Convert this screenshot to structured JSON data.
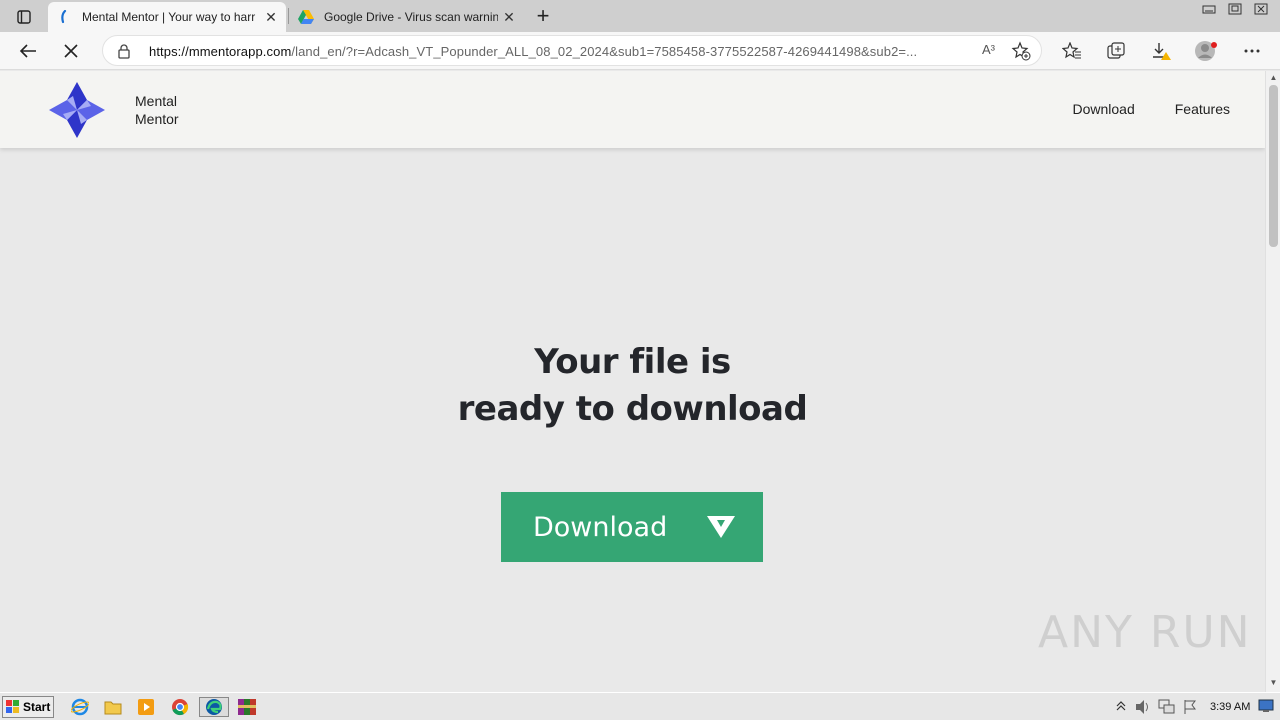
{
  "browser": {
    "tabs": [
      {
        "title": "Mental Mentor | Your way to harr",
        "active": true
      },
      {
        "title": "Google Drive - Virus scan warnin",
        "active": false
      }
    ],
    "url_host": "https://mmentorapp.com",
    "url_path": "/land_en/?r=Adcash_VT_Popunder_ALL_08_02_2024&sub1=7585458-3775522587-4269441498&sub2=...",
    "read_aloud_label": "A³"
  },
  "site": {
    "brand_line1": "Mental",
    "brand_line2": "Mentor",
    "nav": [
      "Download",
      "Features"
    ],
    "hero_line1": "Your file is",
    "hero_line2": "ready to download",
    "download_button": "Download",
    "accent_color": "#35a674",
    "logo_color": "#3b44d6"
  },
  "watermark": "ANY RUN",
  "taskbar": {
    "start_label": "Start",
    "time": "3:39 AM"
  }
}
